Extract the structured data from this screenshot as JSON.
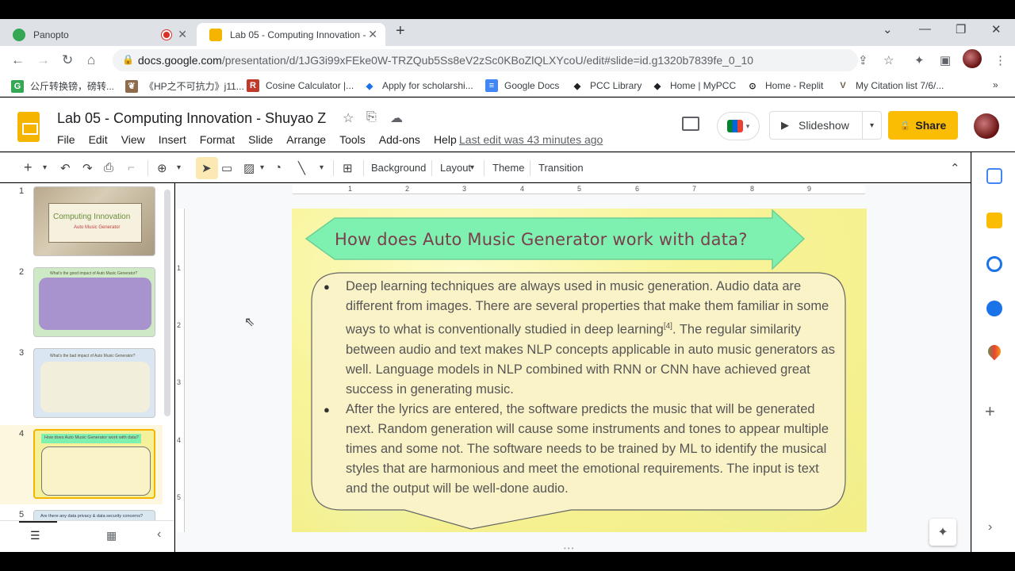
{
  "browser": {
    "tabs": [
      {
        "label": "Panopto",
        "icon": "panopto-icon"
      },
      {
        "label": "Lab 05 - Computing Innovation -",
        "icon": "slides-icon"
      }
    ],
    "url_host": "docs.google.com",
    "url_path": "/presentation/d/1JG3i99xFEke0W-TRZQub5Ss8eV2zSc0KBoZlQLXYcoU/edit#slide=id.g1320b7839fe_0_10",
    "bookmarks": [
      {
        "label": "公斤转换镑，磅转...",
        "color": "#34a853",
        "glyph": "G"
      },
      {
        "label": "《HP之不可抗力》j11...",
        "color": "#8e6b4a",
        "glyph": "❦"
      },
      {
        "label": "Cosine Calculator |...",
        "color": "#c0392b",
        "glyph": "R"
      },
      {
        "label": "Apply for scholarshi...",
        "color": "#1a73e8",
        "glyph": "◆"
      },
      {
        "label": "Google Docs",
        "color": "#4285f4",
        "glyph": "≡"
      },
      {
        "label": "PCC Library",
        "color": "#202124",
        "glyph": "◆"
      },
      {
        "label": "Home | MyPCC",
        "color": "#202124",
        "glyph": "◆"
      },
      {
        "label": "Home - Replit",
        "color": "#202124",
        "glyph": "⊙"
      },
      {
        "label": "My Citation list 7/6/...",
        "color": "#6b5e4a",
        "glyph": "V"
      }
    ]
  },
  "doc": {
    "title": "Lab 05 - Computing Innovation - Shuyao Z",
    "menu": [
      "File",
      "Edit",
      "View",
      "Insert",
      "Format",
      "Slide",
      "Arrange",
      "Tools",
      "Add-ons",
      "Help"
    ],
    "last_edit": "Last edit was 43 minutes ago",
    "slideshow_label": "Slideshow",
    "share_label": "Share"
  },
  "toolbar": {
    "background": "Background",
    "layout": "Layout",
    "theme": "Theme",
    "transition": "Transition"
  },
  "filmstrip": {
    "slides": [
      {
        "num": "1",
        "title": "Computing Innovation",
        "subtitle": "Auto Music Generator"
      },
      {
        "num": "2",
        "title": "What's the good impact of Auto Music Generator?"
      },
      {
        "num": "3",
        "title": "What's the bad impact of Auto Music Generator?"
      },
      {
        "num": "4",
        "title": "How does Auto Music Generator work with data?"
      },
      {
        "num": "5",
        "title": "Are there any data privacy & data security concerns?"
      }
    ]
  },
  "ruler": {
    "h": [
      "1",
      "2",
      "3",
      "4",
      "5",
      "6",
      "7",
      "8",
      "9"
    ],
    "v": [
      "1",
      "2",
      "3",
      "4",
      "5"
    ]
  },
  "slide": {
    "title": "How does Auto Music Generator work with data?",
    "bullet1_a": "Deep learning techniques are always used in music generation. Audio data are different from images. There are several properties that make them familiar in some ways to what is conventionally studied in deep learning",
    "bullet1_ref": "[4]",
    "bullet1_b": ". The regular similarity between audio and text makes NLP concepts applicable in auto music generators as well. Language models in NLP combined with RNN or CNN have achieved great success in generating music.",
    "bullet2": "After the lyrics are entered, the software predicts the music that will be generated next. Random generation will cause some instruments and tones to appear multiple times and some not. The software needs to be trained by ML to identify the musical styles that are harmonious and meet the emotional requirements. The input is text and the output will be well-done audio."
  },
  "colors": {
    "arrow_fill": "#7ef0b0",
    "title_color": "#7a3e4c",
    "bubble_fill": "#fbf3c8",
    "share_yellow": "#fbbc04",
    "selected_border": "#f4b400"
  }
}
